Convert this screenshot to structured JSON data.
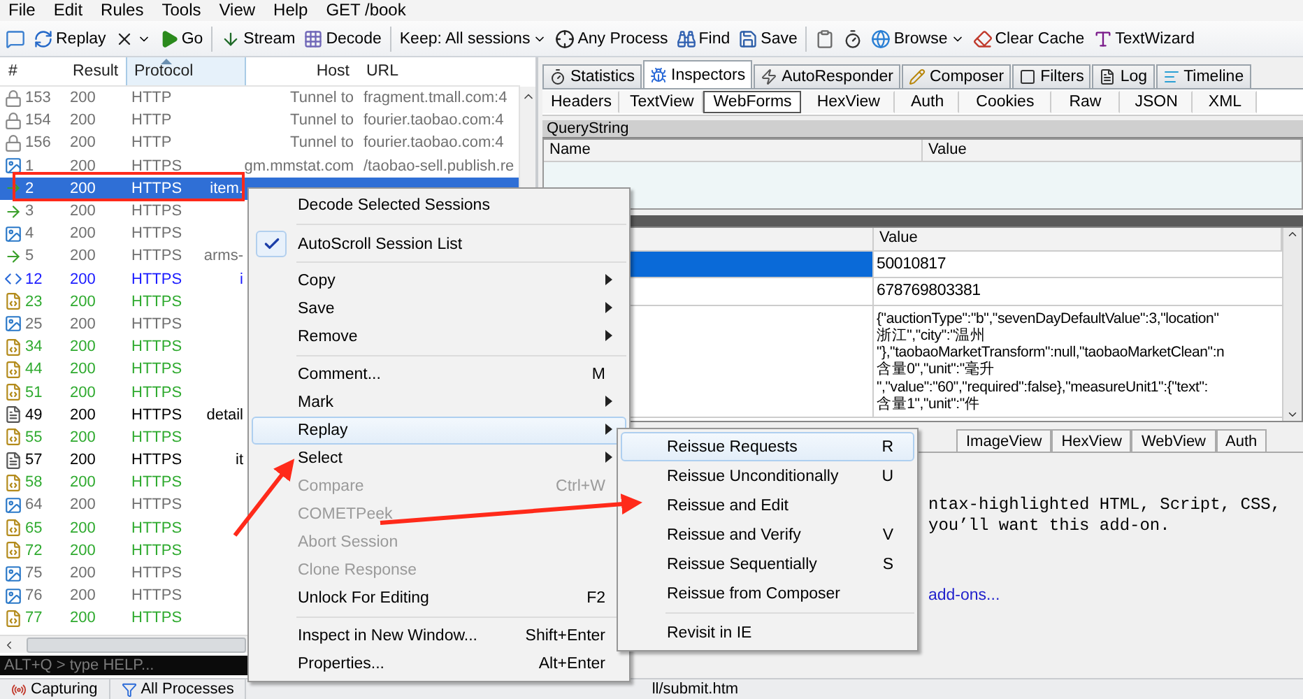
{
  "menu_bar": {
    "items": [
      "File",
      "Edit",
      "Rules",
      "Tools",
      "View",
      "Help"
    ],
    "request": "GET /book"
  },
  "toolbar": [
    {
      "kind": "comment",
      "dropdown": false
    },
    {
      "kind": "replay",
      "label": "Replay",
      "dropdown": false
    },
    {
      "kind": "remove",
      "dropdown": true
    },
    {
      "kind": "go",
      "label": "Go",
      "dropdown": false
    },
    {
      "kind": "separator"
    },
    {
      "kind": "stream",
      "label": "Stream",
      "dropdown": false
    },
    {
      "kind": "decode",
      "label": "Decode",
      "dropdown": false
    },
    {
      "kind": "separator"
    },
    {
      "kind": "keep",
      "label": "Keep: All sessions",
      "dropdown": true
    },
    {
      "kind": "process",
      "label": "Any Process",
      "dropdown": false
    },
    {
      "kind": "find",
      "label": "Find",
      "dropdown": false
    },
    {
      "kind": "save",
      "label": "Save",
      "dropdown": false
    },
    {
      "kind": "separator"
    },
    {
      "kind": "snapshot",
      "dropdown": false
    },
    {
      "kind": "timer",
      "dropdown": false
    },
    {
      "kind": "browse",
      "label": "Browse",
      "dropdown": true
    },
    {
      "kind": "cache",
      "label": "Clear Cache",
      "dropdown": false
    },
    {
      "kind": "wizard",
      "label": "TextWizard",
      "dropdown": false
    }
  ],
  "sessions": {
    "columns": [
      {
        "label": "#",
        "sorted": false
      },
      {
        "label": "Result",
        "sorted": false
      },
      {
        "label": "Protocol",
        "sorted": true
      },
      {
        "label": "Host",
        "sorted": false
      },
      {
        "label": "URL",
        "sorted": false
      }
    ],
    "rows": [
      {
        "id": "153",
        "result": "200",
        "protocol": "HTTP",
        "host": "Tunnel to",
        "url": "fragment.tmall.com:4",
        "kind": "tunnel",
        "color": "#707070",
        "selected": false
      },
      {
        "id": "154",
        "result": "200",
        "protocol": "HTTP",
        "host": "Tunnel to",
        "url": "fourier.taobao.com:4",
        "kind": "tunnel",
        "color": "#707070",
        "selected": false
      },
      {
        "id": "156",
        "result": "200",
        "protocol": "HTTP",
        "host": "Tunnel to",
        "url": "fourier.taobao.com:4",
        "kind": "tunnel",
        "color": "#707070",
        "selected": false
      },
      {
        "id": "1",
        "result": "200",
        "protocol": "HTTPS",
        "host": "gm.mmstat.com",
        "url": "/taobao-sell.publish.re",
        "kind": "image",
        "color": "#707070",
        "selected": false
      },
      {
        "id": "2",
        "result": "200",
        "protocol": "HTTPS",
        "host": "item.",
        "kind": "post",
        "color": "#ffffff",
        "selected": true
      },
      {
        "id": "3",
        "result": "200",
        "protocol": "HTTPS",
        "kind": "post",
        "color": "#707070",
        "selected": false
      },
      {
        "id": "4",
        "result": "200",
        "protocol": "HTTPS",
        "kind": "image",
        "color": "#707070",
        "selected": false
      },
      {
        "id": "5",
        "result": "200",
        "protocol": "HTTPS",
        "host": "arms-",
        "kind": "post",
        "color": "#707070",
        "selected": false
      },
      {
        "id": "12",
        "result": "200",
        "protocol": "HTTPS",
        "host": "i",
        "kind": "code",
        "color": "#1a1aff",
        "selected": false
      },
      {
        "id": "23",
        "result": "200",
        "protocol": "HTTPS",
        "kind": "script",
        "color": "#2faa2f",
        "selected": false
      },
      {
        "id": "25",
        "result": "200",
        "protocol": "HTTPS",
        "kind": "image",
        "color": "#707070",
        "selected": false
      },
      {
        "id": "34",
        "result": "200",
        "protocol": "HTTPS",
        "kind": "script",
        "color": "#2faa2f",
        "selected": false
      },
      {
        "id": "44",
        "result": "200",
        "protocol": "HTTPS",
        "kind": "script",
        "color": "#2faa2f",
        "selected": false
      },
      {
        "id": "51",
        "result": "200",
        "protocol": "HTTPS",
        "kind": "script",
        "color": "#2faa2f",
        "selected": false
      },
      {
        "id": "49",
        "result": "200",
        "protocol": "HTTPS",
        "host": "detail",
        "kind": "text",
        "color": "#000000",
        "selected": false
      },
      {
        "id": "55",
        "result": "200",
        "protocol": "HTTPS",
        "kind": "script",
        "color": "#2faa2f",
        "selected": false
      },
      {
        "id": "57",
        "result": "200",
        "protocol": "HTTPS",
        "host": "it",
        "kind": "text",
        "color": "#000000",
        "selected": false
      },
      {
        "id": "58",
        "result": "200",
        "protocol": "HTTPS",
        "kind": "script",
        "color": "#2faa2f",
        "selected": false
      },
      {
        "id": "64",
        "result": "200",
        "protocol": "HTTPS",
        "kind": "image",
        "color": "#707070",
        "selected": false
      },
      {
        "id": "65",
        "result": "200",
        "protocol": "HTTPS",
        "kind": "script",
        "color": "#2faa2f",
        "selected": false
      },
      {
        "id": "72",
        "result": "200",
        "protocol": "HTTPS",
        "kind": "script",
        "color": "#2faa2f",
        "selected": false
      },
      {
        "id": "75",
        "result": "200",
        "protocol": "HTTPS",
        "kind": "image",
        "color": "#707070",
        "selected": false
      },
      {
        "id": "76",
        "result": "200",
        "protocol": "HTTPS",
        "kind": "image",
        "color": "#707070",
        "selected": false
      },
      {
        "id": "77",
        "result": "200",
        "protocol": "HTTPS",
        "kind": "script",
        "color": "#2faa2f",
        "selected": false
      }
    ]
  },
  "quick_exec": {
    "placeholder": "ALT+Q > type HELP..."
  },
  "status_bar": {
    "items": [
      "Capturing",
      "All Processes"
    ],
    "url": "ll/submit.htm"
  },
  "tabs": [
    {
      "label": "Statistics",
      "kind": "statistics",
      "selected": false
    },
    {
      "label": "Inspectors",
      "kind": "inspectors",
      "selected": true
    },
    {
      "label": "AutoResponder",
      "kind": "autoresponder",
      "selected": false
    },
    {
      "label": "Composer",
      "kind": "composer",
      "selected": false
    },
    {
      "label": "Filters",
      "kind": "filters",
      "selected": false
    },
    {
      "label": "Log",
      "kind": "log",
      "selected": false
    },
    {
      "label": "Timeline",
      "kind": "timeline",
      "selected": false
    }
  ],
  "request_tabs": [
    {
      "label": "Headers",
      "selected": false
    },
    {
      "label": "TextView",
      "selected": false
    },
    {
      "label": "WebForms",
      "selected": true
    },
    {
      "label": "HexView",
      "selected": false
    },
    {
      "label": "Auth",
      "selected": false
    },
    {
      "label": "Cookies",
      "selected": false
    },
    {
      "label": "Raw",
      "selected": false
    },
    {
      "label": "JSON",
      "selected": false
    },
    {
      "label": "XML",
      "selected": false
    }
  ],
  "query_string": {
    "title": "QueryString",
    "columns": [
      "Name",
      "Value"
    ]
  },
  "body_table": {
    "column": "Value",
    "rows": [
      {
        "value": [
          "50010817"
        ],
        "selected": true
      },
      {
        "value": [
          "678769803381"
        ],
        "selected": false
      },
      {
        "value": [
          "{\"auctionType\":\"b\",\"sevenDayDefaultValue\":3,\"location\"",
          "浙江\",\"city\":\"温州",
          "\"},\"taobaoMarketTransform\":null,\"taobaoMarketClean\":n",
          "含量0\",\"unit\":\"毫升",
          "\",\"value\":\"60\",\"required\":false},\"measureUnit1\":{\"text\":",
          "含量1\",\"unit\":\"件"
        ],
        "selected": false
      }
    ]
  },
  "response_tabs": [
    "ImageView",
    "HexView",
    "WebView",
    "Auth"
  ],
  "response": {
    "lines": [
      "ntax-highlighted HTML, Script, CSS,",
      "you’ll want this add-on."
    ],
    "link": "add-ons..."
  },
  "context_menu": [
    {
      "kind": "item",
      "label": "Decode Selected Sessions",
      "submenu": false,
      "checked": false,
      "disabled": false,
      "highlighted": false
    },
    {
      "kind": "separator"
    },
    {
      "kind": "item",
      "label": "AutoScroll Session List",
      "submenu": false,
      "checked": true,
      "disabled": false,
      "highlighted": false
    },
    {
      "kind": "separator"
    },
    {
      "kind": "item",
      "label": "Copy",
      "submenu": true,
      "checked": false,
      "disabled": false,
      "highlighted": false
    },
    {
      "kind": "item",
      "label": "Save",
      "submenu": true,
      "checked": false,
      "disabled": false,
      "highlighted": false
    },
    {
      "kind": "item",
      "label": "Remove",
      "submenu": true,
      "checked": false,
      "disabled": false,
      "highlighted": false
    },
    {
      "kind": "separator"
    },
    {
      "kind": "item",
      "label": "Comment...",
      "shortcut": "M",
      "submenu": false,
      "checked": false,
      "disabled": false,
      "highlighted": false
    },
    {
      "kind": "item",
      "label": "Mark",
      "submenu": true,
      "checked": false,
      "disabled": false,
      "highlighted": false
    },
    {
      "kind": "item",
      "label": "Replay",
      "submenu": true,
      "checked": false,
      "disabled": false,
      "highlighted": true
    },
    {
      "kind": "item",
      "label": "Select",
      "submenu": true,
      "checked": false,
      "disabled": false,
      "highlighted": false
    },
    {
      "kind": "item",
      "label": "Compare",
      "shortcut": "Ctrl+W",
      "submenu": false,
      "checked": false,
      "disabled": true,
      "highlighted": false
    },
    {
      "kind": "item",
      "label": "COMETPeek",
      "submenu": false,
      "checked": false,
      "disabled": true,
      "highlighted": false
    },
    {
      "kind": "item",
      "label": "Abort Session",
      "submenu": false,
      "checked": false,
      "disabled": true,
      "highlighted": false
    },
    {
      "kind": "item",
      "label": "Clone Response",
      "submenu": false,
      "checked": false,
      "disabled": true,
      "highlighted": false
    },
    {
      "kind": "item",
      "label": "Unlock For Editing",
      "shortcut": "F2",
      "submenu": false,
      "checked": false,
      "disabled": false,
      "highlighted": false
    },
    {
      "kind": "separator"
    },
    {
      "kind": "item",
      "label": "Inspect in New Window...",
      "shortcut": "Shift+Enter",
      "submenu": false,
      "checked": false,
      "disabled": false,
      "highlighted": false
    },
    {
      "kind": "item",
      "label": "Properties...",
      "shortcut": "Alt+Enter",
      "submenu": false,
      "checked": false,
      "disabled": false,
      "highlighted": false
    }
  ],
  "replay_submenu": [
    {
      "kind": "item",
      "label": "Reissue Requests",
      "shortcut": "R",
      "highlighted": true
    },
    {
      "kind": "item",
      "label": "Reissue Unconditionally",
      "shortcut": "U",
      "highlighted": false
    },
    {
      "kind": "item",
      "label": "Reissue and Edit",
      "highlighted": false
    },
    {
      "kind": "item",
      "label": "Reissue and Verify",
      "shortcut": "V",
      "highlighted": false
    },
    {
      "kind": "item",
      "label": "Reissue Sequentially",
      "shortcut": "S",
      "highlighted": false
    },
    {
      "kind": "item",
      "label": "Reissue from Composer",
      "highlighted": false
    },
    {
      "kind": "separator"
    },
    {
      "kind": "item",
      "label": "Revisit in IE",
      "highlighted": false
    }
  ]
}
